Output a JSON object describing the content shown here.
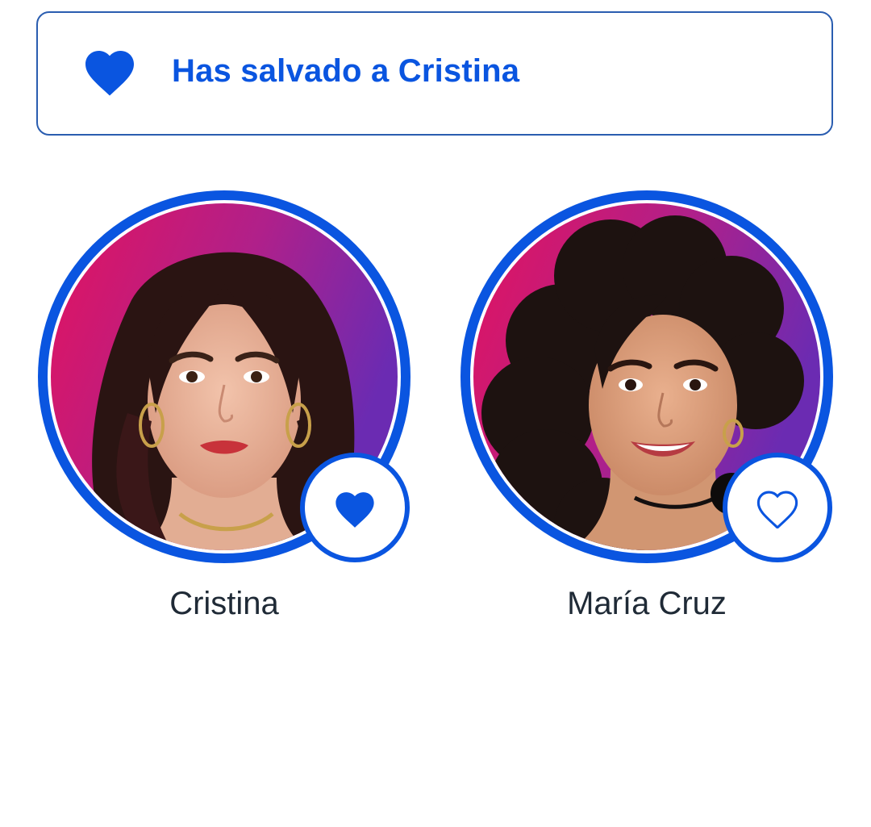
{
  "banner": {
    "message": "Has salvado a Cristina",
    "icon": "heart-filled-icon"
  },
  "candidates": [
    {
      "name": "Cristina",
      "vote_icon": "heart-filled-icon",
      "selected": true
    },
    {
      "name": "María Cruz",
      "vote_icon": "heart-outline-icon",
      "selected": false
    }
  ],
  "colors": {
    "accent": "#0a55e0",
    "banner_border": "#2a5db0",
    "name_text": "#1f2a36",
    "photo_bg_pink": "#e3135f",
    "photo_bg_purple": "#7a2ab0"
  }
}
